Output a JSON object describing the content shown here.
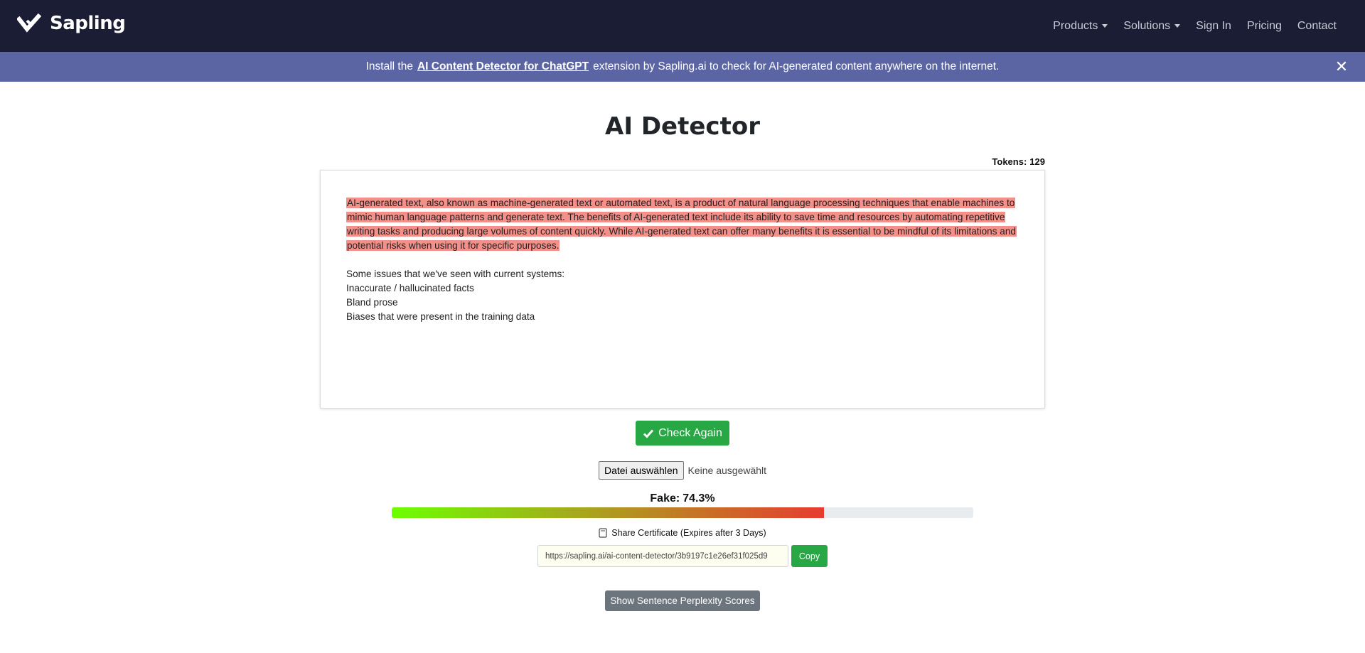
{
  "nav": {
    "brand_name": "Sapling",
    "items": [
      {
        "label": "Products",
        "dropdown": true
      },
      {
        "label": "Solutions",
        "dropdown": true
      },
      {
        "label": "Sign In",
        "dropdown": false
      },
      {
        "label": "Pricing",
        "dropdown": false
      },
      {
        "label": "Contact",
        "dropdown": false
      }
    ]
  },
  "banner": {
    "prefix": "Install the",
    "link_text": "AI Content Detector for ChatGPT",
    "suffix": "extension by Sapling.ai to check for AI-generated content anywhere on the internet.",
    "close_icon": "close-icon"
  },
  "page": {
    "title": "AI Detector",
    "tokens_label": "Tokens:",
    "tokens_value": "129"
  },
  "editor": {
    "highlighted_paragraph": "AI-generated text, also known as machine-generated text or automated text, is a product of natural language processing techniques that enable machines to mimic human language patterns and generate text. The benefits of AI-generated text include its ability to save time and resources by automating repetitive writing tasks and producing large volumes of content quickly. While AI-generated text can offer many benefits it is essential to be mindful of its limitations and potential risks when using it for specific purposes.",
    "lines": [
      "Some issues that we've seen with current systems:",
      "Inaccurate / hallucinated facts",
      "Bland prose",
      "Biases that were present in the training data"
    ],
    "highlight_color": "#f3908a"
  },
  "actions": {
    "check_label": "Check Again",
    "file_button": "Datei auswählen",
    "file_status": "Keine ausgewählt"
  },
  "result": {
    "fake_label": "Fake:",
    "fake_pct_text": "74.3%",
    "fake_fraction": 0.743,
    "share_label": "Share Certificate (Expires after 3 Days)",
    "share_url": "https://sapling.ai/ai-content-detector/3b9197c1e26ef31f025d9",
    "copy_label": "Copy",
    "perplexity_label": "Show Sentence Perplexity Scores"
  },
  "colors": {
    "navbar": "#1a1d33",
    "banner": "#5c65a3",
    "success": "#28a745",
    "secondary": "#6c757d"
  }
}
